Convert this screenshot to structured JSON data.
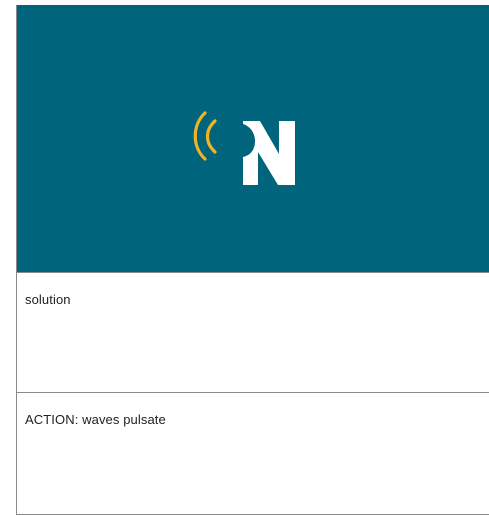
{
  "logo": {
    "icon": "signal-waves-n-logo",
    "letter": "N",
    "colors": {
      "background": "#00647d",
      "waves": "#f0b323",
      "letter": "#ffffff"
    }
  },
  "panels": [
    {
      "text": "solution"
    },
    {
      "text": "ACTION: waves pulsate"
    }
  ]
}
